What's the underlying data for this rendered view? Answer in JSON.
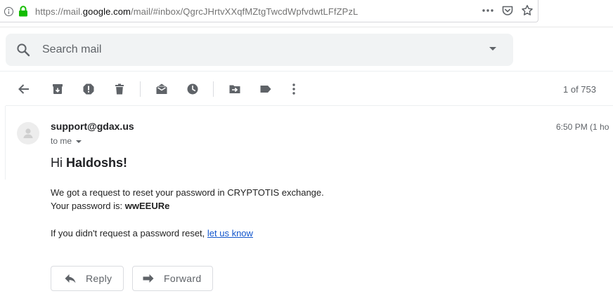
{
  "browser": {
    "url_prefix": "https://mail.",
    "url_domain": "google.com",
    "url_suffix": "/mail/#inbox/QgrcJHrtvXXqfMZtgTwcdWpfvdwtLFfZPzL"
  },
  "search": {
    "placeholder": "Search mail"
  },
  "toolbar": {
    "pager": "1 of 753"
  },
  "message": {
    "sender": "support@gdax.us",
    "recipient": "to me",
    "time": "6:50 PM (1 ho",
    "greeting_prefix": "Hi ",
    "greeting_name": "Haldoshs!",
    "line1": "We got a request to reset your password in CRYPTOTIS exchange.",
    "line2_prefix": "Your password is: ",
    "line2_password": "wwEEURe",
    "line3_prefix": "If you didn't request a password reset, ",
    "line3_link": "let us know"
  },
  "actions": {
    "reply_label": "Reply",
    "forward_label": "Forward"
  },
  "icons": {
    "lock": "lock-icon",
    "search": "search-icon",
    "back": "back-arrow-icon",
    "archive": "archive-icon",
    "spam": "report-spam-icon",
    "delete": "trash-icon",
    "mark_unread": "mark-unread-icon",
    "snooze": "snooze-clock-icon",
    "move": "move-to-icon",
    "label": "label-icon",
    "more": "more-vert-icon"
  },
  "colors": {
    "lock_green": "#12bc00",
    "link_blue": "#1155cc",
    "icon_gray": "#5f6368"
  }
}
